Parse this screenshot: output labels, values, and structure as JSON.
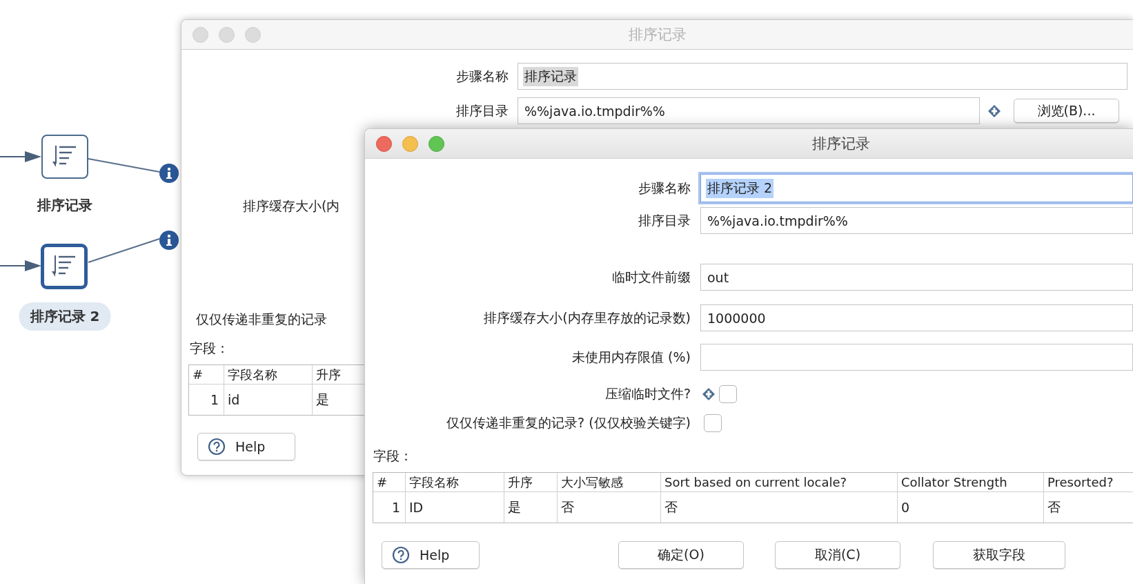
{
  "canvas": {
    "steps": [
      {
        "label": "排序记录",
        "selected": false
      },
      {
        "label": "排序记录 2",
        "selected": true
      }
    ]
  },
  "back_dialog": {
    "title": "排序记录",
    "active": false,
    "fields": [
      {
        "label": "步骤名称",
        "value": "排序记录",
        "highlighted": true,
        "focused": false
      },
      {
        "label": "排序目录",
        "value": "%%java.io.tmpdir%%",
        "highlighted": false,
        "focused": false,
        "variable": true,
        "button": "浏览(B)..."
      }
    ],
    "partial_labels": [
      "排序缓存大小(内",
      "仅仅传递非重复的记录"
    ],
    "table_label": "字段：",
    "table": {
      "columns": [
        "#",
        "字段名称",
        "升序"
      ],
      "rows": [
        [
          "1",
          "id",
          "是"
        ]
      ]
    },
    "help_button": "Help"
  },
  "front_dialog": {
    "title": "排序记录",
    "active": true,
    "fields": [
      {
        "kind": "text",
        "label": "步骤名称",
        "value": "排序记录 2",
        "highlighted": true,
        "focused": true
      },
      {
        "kind": "text",
        "label": "排序目录",
        "value": "%%java.io.tmpdir%%",
        "highlighted": false,
        "focused": false
      },
      {
        "kind": "text",
        "label": "临时文件前缀",
        "value": "out",
        "highlighted": false,
        "focused": false
      },
      {
        "kind": "text",
        "label": "排序缓存大小(内存里存放的记录数)",
        "value": "1000000",
        "highlighted": false,
        "focused": false
      },
      {
        "kind": "text",
        "label": "未使用内存限值 (%)",
        "focused": false
      },
      {
        "kind": "checkbox",
        "label": "压缩临时文件?",
        "variable": true,
        "checked": false
      },
      {
        "kind": "checkbox",
        "label": "仅仅传递非重复的记录? (仅仅校验关键字)",
        "checked": false
      }
    ],
    "table_label": "字段：",
    "table": {
      "columns": [
        "#",
        "字段名称",
        "升序",
        "大小写敏感",
        "Sort based on current locale?",
        "Collator Strength",
        "Presorted?"
      ],
      "rows": [
        [
          "1",
          "ID",
          "是",
          "否",
          "否",
          "0",
          "否"
        ]
      ]
    },
    "help_button": "Help",
    "buttons": [
      "确定(O)",
      "取消(C)",
      "获取字段"
    ]
  }
}
